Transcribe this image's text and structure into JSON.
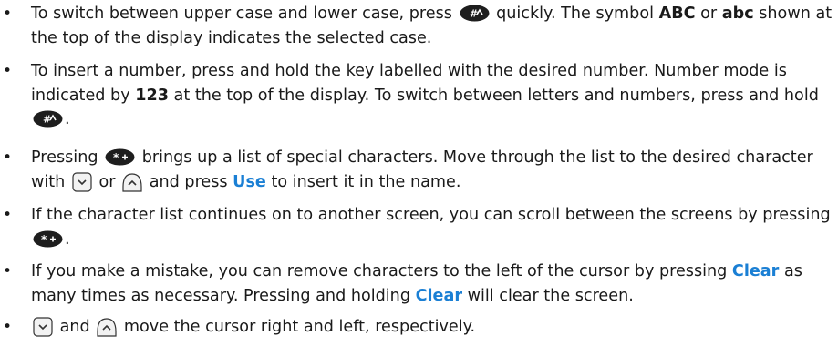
{
  "bullet_char": "•",
  "colors": {
    "text": "#1a1a1a",
    "softkey": "#1a7fd4",
    "key_fill": "#1e1e1e"
  },
  "items": [
    {
      "t1": "To switch between upper case and lower case, press",
      "t2": "quickly. The symbol",
      "b1": "ABC",
      "t3": "or",
      "b2": "abc",
      "t4": "shown at the top of the display indicates the selected case."
    },
    {
      "t1": "To insert a number, press and hold the key labelled with the desired number. Number mode is indicated by",
      "b1": "123",
      "t2": "at the top of the display. To switch between letters and numbers, press and hold",
      "t3": "."
    },
    {
      "t1": "Pressing",
      "t2": "brings up a list of special characters. Move through the list to the desired character with",
      "t3": "or",
      "t4": "and press",
      "s1": "Use",
      "t5": "to insert it in the name."
    },
    {
      "t1": "If the character list continues on to another screen, you can scroll between the screens by pressing",
      "t2": "."
    },
    {
      "t1": "If you make a mistake, you can remove characters to the left of the cursor by pressing",
      "s1": "Clear",
      "t2": "as many times as necessary. Pressing and holding",
      "s2": "Clear",
      "t3": "will clear the screen."
    },
    {
      "t1": "and",
      "t2": "move the cursor right and left, respectively."
    }
  ]
}
